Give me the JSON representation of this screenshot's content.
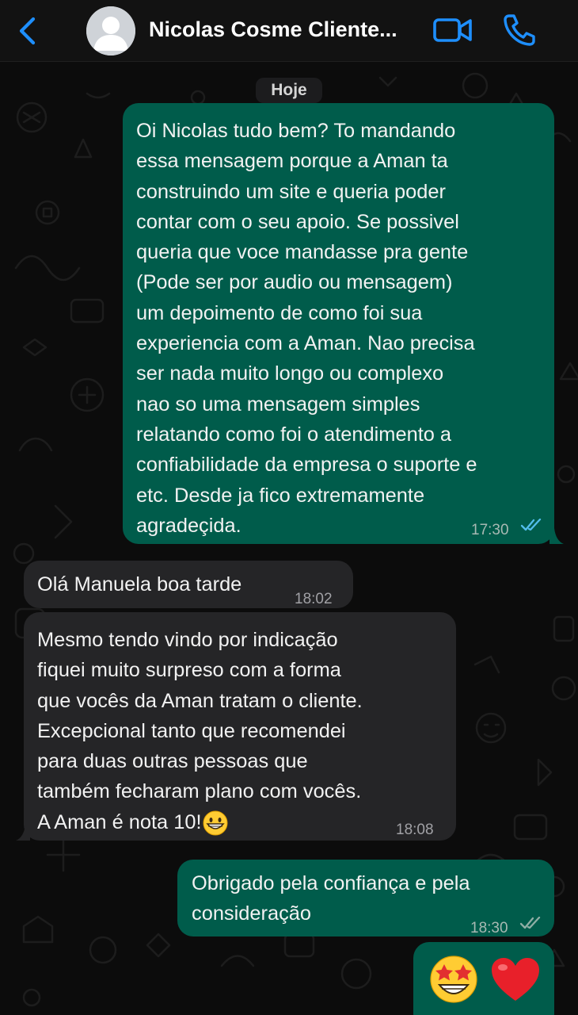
{
  "header": {
    "contact_name": "Nicolas Cosme Cliente...",
    "back_icon": "chevron-left-icon",
    "avatar_icon": "default-avatar-icon",
    "video_icon": "video-camera-icon",
    "call_icon": "phone-icon",
    "accent_color": "#1e8fff"
  },
  "chat": {
    "date_label": "Hoje",
    "messages": [
      {
        "direction": "outgoing",
        "text": "Oi Nicolas tudo bem? To mandando\nessa mensagem porque a Aman ta\nconstruindo um site e queria poder\ncontar com o seu apoio. Se possivel\nqueria que voce mandasse pra gente\n(Pode ser por audio ou mensagem)\num depoimento de como foi sua\nexperiencia com a Aman. Nao precisa\nser nada muito longo ou complexo\nnao so uma mensagem simples\nrelatando como foi o atendimento a\nconfiabilidade da empresa o suporte e\netc. Desde ja fico extremamente\nagradeçida.",
        "time": "17:30",
        "status": "read"
      },
      {
        "direction": "incoming",
        "text": "Olá Manuela boa tarde",
        "time": "18:02"
      },
      {
        "direction": "incoming",
        "text": "Mesmo tendo vindo por indicação\nfiquei muito surpreso com a forma\nque vocês da Aman tratam o cliente.\nExcepcional tanto que recomendei\npara duas outras pessoas que\ntambém fecharam plano com vocês.\nA Aman é nota 10!",
        "emoji": "grinning-face-icon",
        "time": "18:08"
      },
      {
        "direction": "outgoing",
        "text": "Obrigado pela confiança e pela\nconsideração",
        "time": "18:30",
        "status": "delivered"
      },
      {
        "direction": "outgoing",
        "emojis": [
          "star-struck-face-icon",
          "red-heart-icon"
        ]
      }
    ]
  },
  "colors": {
    "outgoing_bubble": "#005c4b",
    "incoming_bubble": "#252527",
    "read_ticks": "#53bdeb",
    "delivered_ticks": "#8faea5"
  }
}
